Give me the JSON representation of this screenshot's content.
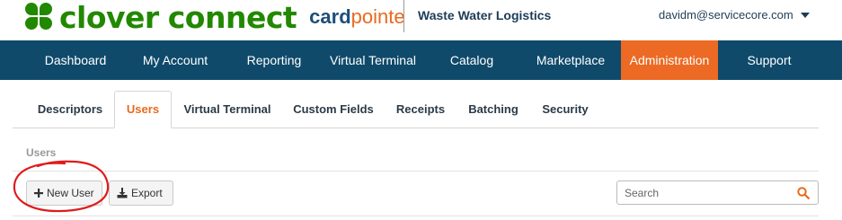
{
  "header": {
    "brand": {
      "clover": "clover",
      "connect": "connect",
      "card": "card",
      "pointe": "pointe"
    },
    "merchant_name": "Waste Water Logistics",
    "user_email": "davidm@servicecore.com",
    "icons": {
      "logo": "clover-logo-icon",
      "user_menu": "chevron-down-icon"
    }
  },
  "nav": {
    "items": [
      {
        "label": "Dashboard"
      },
      {
        "label": "My Account"
      },
      {
        "label": "Reporting"
      },
      {
        "label": "Virtual Terminal"
      },
      {
        "label": "Catalog"
      },
      {
        "label": "Marketplace"
      },
      {
        "label": "Administration"
      },
      {
        "label": "Support"
      }
    ],
    "active": "Administration",
    "colors": {
      "background": "#0f4a6b",
      "active": "#ec6a24"
    }
  },
  "tabs": {
    "items": [
      {
        "label": "Descriptors"
      },
      {
        "label": "Users"
      },
      {
        "label": "Virtual Terminal"
      },
      {
        "label": "Custom Fields"
      },
      {
        "label": "Receipts"
      },
      {
        "label": "Batching"
      },
      {
        "label": "Security"
      }
    ],
    "active": "Users"
  },
  "section": {
    "title": "Users"
  },
  "toolbar": {
    "new_user_label": "New User",
    "export_label": "Export",
    "icons": {
      "new_user": "plus-icon",
      "export": "download-icon",
      "search": "search-icon"
    }
  },
  "search": {
    "placeholder": "Search",
    "value": ""
  },
  "annotation": {
    "type": "red-hand-drawn-circle",
    "color": "#e01b1b"
  }
}
